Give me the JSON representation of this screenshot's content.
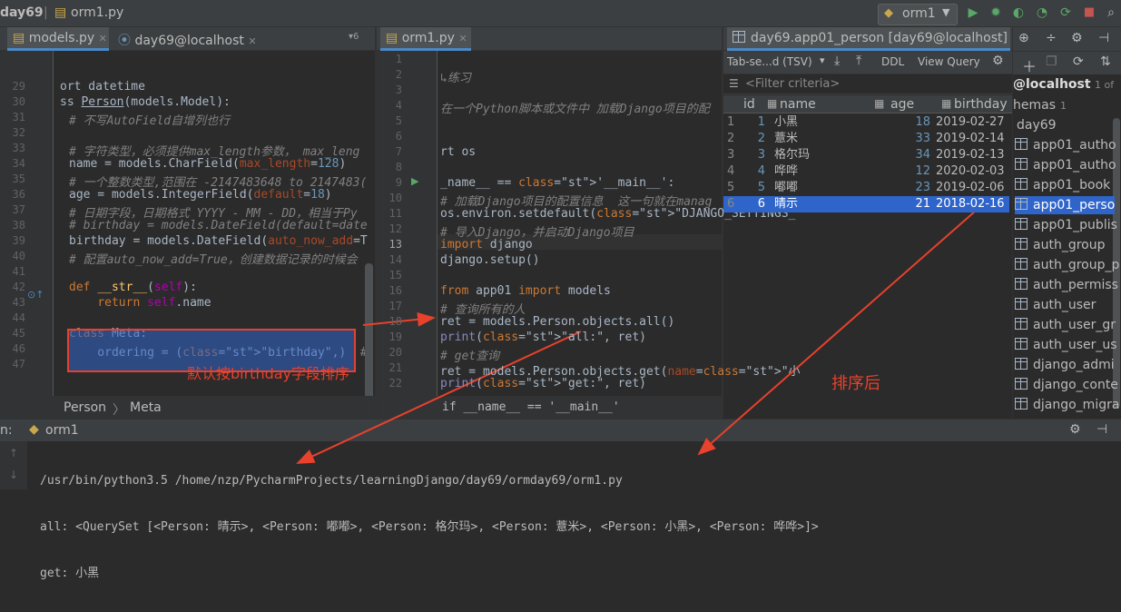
{
  "titlebar": {
    "project": "day69",
    "file": "orm1.py",
    "run_config": "orm1"
  },
  "left_editor": {
    "tabs": [
      {
        "label": "models.py"
      },
      {
        "label": "day69@localhost"
      }
    ],
    "tab_count_hint": "▾6",
    "lines": [
      {
        "n": "29",
        "text": "ort datetime"
      },
      {
        "n": "30",
        "text": "ss Person(models.Model):"
      },
      {
        "n": "31",
        "text": "# 不写AutoField自增列也行"
      },
      {
        "n": "32",
        "text": ""
      },
      {
        "n": "33",
        "text": "# 字符类型，必须提供max_length参数， max_leng"
      },
      {
        "n": "34",
        "text": "name = models.CharField(max_length=128)"
      },
      {
        "n": "35",
        "text": "# 一个整数类型,范围在 -2147483648 to 2147483("
      },
      {
        "n": "36",
        "text": "age = models.IntegerField(default=18)"
      },
      {
        "n": "37",
        "text": "# 日期字段，日期格式 YYYY - MM - DD，相当于Py"
      },
      {
        "n": "38",
        "text": "# birthday = models.DateField(default=date"
      },
      {
        "n": "39",
        "text": "birthday = models.DateField(auto_now_add=T"
      },
      {
        "n": "40",
        "text": "# 配置auto_now_add=True，创建数据记录的时候会"
      },
      {
        "n": "41",
        "text": ""
      },
      {
        "n": "42",
        "text": "def __str__(self):"
      },
      {
        "n": "43",
        "text": "    return self.name"
      },
      {
        "n": "44",
        "text": ""
      },
      {
        "n": "45",
        "text": "class Meta:"
      },
      {
        "n": "46",
        "text": "    ordering = (\"birthday\",)  # 使其有序"
      },
      {
        "n": "47",
        "text": ""
      }
    ],
    "breadcrumb": [
      "Person",
      "Meta"
    ],
    "annotation": "默认按birthday字段排序"
  },
  "mid_editor": {
    "tabs": [
      {
        "label": "orm1.py"
      }
    ],
    "lines": [
      {
        "n": "1",
        "text": ""
      },
      {
        "n": "2",
        "text": "↳练习"
      },
      {
        "n": "3",
        "text": ""
      },
      {
        "n": "4",
        "text": "在一个Python脚本或文件中 加载Django项目的配"
      },
      {
        "n": "5",
        "text": ""
      },
      {
        "n": "6",
        "text": ""
      },
      {
        "n": "7",
        "text": "rt os"
      },
      {
        "n": "8",
        "text": ""
      },
      {
        "n": "9",
        "text": "_name__ == '__main__':"
      },
      {
        "n": "10",
        "text": "# 加载Django项目的配置信息  这一句就在manag"
      },
      {
        "n": "11",
        "text": "os.environ.setdefault(\"DJANGO_SETTINGS_"
      },
      {
        "n": "12",
        "text": "# 导入Django，并启动Django项目"
      },
      {
        "n": "13",
        "text": "import django"
      },
      {
        "n": "14",
        "text": "django.setup()"
      },
      {
        "n": "15",
        "text": ""
      },
      {
        "n": "16",
        "text": "from app01 import models"
      },
      {
        "n": "17",
        "text": "# 查询所有的人"
      },
      {
        "n": "18",
        "text": "ret = models.Person.objects.all()"
      },
      {
        "n": "19",
        "text": "print(\"all:\", ret)"
      },
      {
        "n": "20",
        "text": "# get查询"
      },
      {
        "n": "21",
        "text": "ret = models.Person.objects.get(name=\"小"
      },
      {
        "n": "22",
        "text": "print(\"get:\", ret)"
      }
    ],
    "breadcrumb": "if __name__ == '__main__'"
  },
  "db_view": {
    "tab_label": "day69.app01_person [day69@localhost]",
    "format_select": "Tab-se...d (TSV)",
    "ddl_button": "DDL",
    "view_query_button": "View Query",
    "filter_placeholder": "<Filter criteria>",
    "columns": [
      "id",
      "name",
      "age",
      "birthday"
    ],
    "rows": [
      {
        "row": "1",
        "id": "1",
        "name": "小黑",
        "age": "18",
        "birthday": "2019-02-27"
      },
      {
        "row": "2",
        "id": "2",
        "name": "薏米",
        "age": "33",
        "birthday": "2019-02-14"
      },
      {
        "row": "3",
        "id": "3",
        "name": "格尔玛",
        "age": "34",
        "birthday": "2019-02-13"
      },
      {
        "row": "4",
        "id": "4",
        "name": "哗哗",
        "age": "12",
        "birthday": "2020-02-03"
      },
      {
        "row": "5",
        "id": "5",
        "name": "嘟嘟",
        "age": "23",
        "birthday": "2019-02-06"
      },
      {
        "row": "6",
        "id": "6",
        "name": "晴示",
        "age": "21",
        "birthday": "2018-02-16"
      }
    ],
    "annotation": "排序后"
  },
  "db_tree": {
    "connection": "@localhost",
    "connection_count": "1 of",
    "schemas": "hemas",
    "schemas_count": "1",
    "database": "day69",
    "tables": [
      "app01_autho",
      "app01_autho",
      "app01_book",
      "app01_perso",
      "app01_publis",
      "auth_group",
      "auth_group_p",
      "auth_permiss",
      "auth_user",
      "auth_user_gr",
      "auth_user_us",
      "django_admi",
      "django_conte",
      "django_migra"
    ]
  },
  "run_panel": {
    "label": "n:",
    "config": "orm1",
    "output": [
      "/usr/bin/python3.5 /home/nzp/PycharmProjects/learningDjango/day69/ormday69/orm1.py",
      "all: <QuerySet [<Person: 晴示>, <Person: 嘟嘟>, <Person: 格尔玛>, <Person: 薏米>, <Person: 小黑>, <Person: 哗哗>]>",
      "get: 小黑"
    ]
  },
  "colors": {
    "annotation_red": "#e8412c",
    "selection_blue": "#2f65ca",
    "accent": "#4a88c7"
  }
}
